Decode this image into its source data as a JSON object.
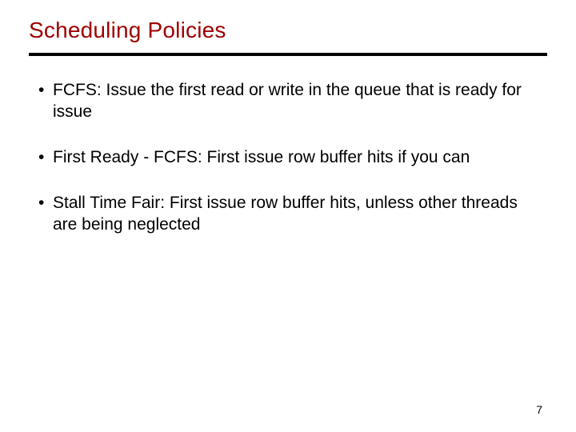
{
  "title": "Scheduling Policies",
  "bullets": [
    "FCFS: Issue the first read or write in the queue that is ready for issue",
    "First Ready - FCFS: First issue row buffer hits if you can",
    "Stall Time Fair: First issue row buffer hits, unless other threads are being neglected"
  ],
  "page_number": "7"
}
